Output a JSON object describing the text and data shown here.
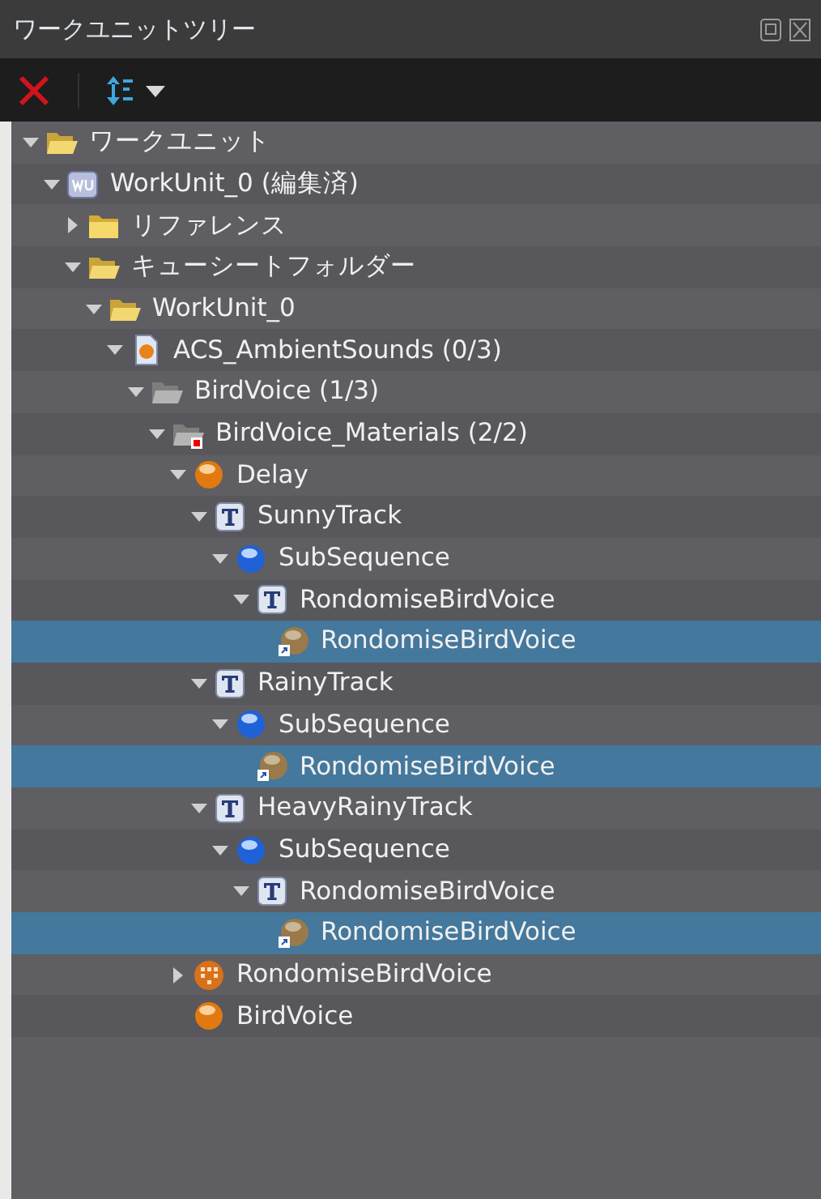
{
  "window": {
    "title": "ワークユニットツリー"
  },
  "tree": [
    {
      "label": "ワークユニット",
      "kind": "folder-open",
      "expanded": true,
      "selected": false,
      "children": [
        {
          "label": "WorkUnit_0 (編集済)",
          "kind": "workunit",
          "expanded": true,
          "selected": false,
          "children": [
            {
              "label": "リファレンス",
              "kind": "folder",
              "expanded": false,
              "selected": false
            },
            {
              "label": "キューシートフォルダー",
              "kind": "folder-open",
              "expanded": true,
              "selected": false,
              "children": [
                {
                  "label": "WorkUnit_0",
                  "kind": "folder-open",
                  "expanded": true,
                  "selected": false,
                  "children": [
                    {
                      "label": "ACS_AmbientSounds (0/3)",
                      "kind": "cuesheet",
                      "expanded": true,
                      "selected": false,
                      "children": [
                        {
                          "label": "BirdVoice (1/3)",
                          "kind": "grey-folder",
                          "expanded": true,
                          "selected": false,
                          "children": [
                            {
                              "label": "BirdVoice_Materials (2/2)",
                              "kind": "materials-folder",
                              "expanded": true,
                              "selected": false,
                              "children": [
                                {
                                  "label": "Delay",
                                  "kind": "orange-sphere",
                                  "expanded": true,
                                  "selected": false,
                                  "children": [
                                    {
                                      "label": "SunnyTrack",
                                      "kind": "track",
                                      "expanded": true,
                                      "selected": false,
                                      "children": [
                                        {
                                          "label": "SubSequence",
                                          "kind": "blue-sphere",
                                          "expanded": true,
                                          "selected": false,
                                          "children": [
                                            {
                                              "label": "RondomiseBirdVoice",
                                              "kind": "track",
                                              "expanded": true,
                                              "selected": false,
                                              "children": [
                                                {
                                                  "label": "RondomiseBirdVoice",
                                                  "kind": "shortcut",
                                                  "selected": true
                                                }
                                              ]
                                            }
                                          ]
                                        }
                                      ]
                                    },
                                    {
                                      "label": "RainyTrack",
                                      "kind": "track",
                                      "expanded": true,
                                      "selected": false,
                                      "children": [
                                        {
                                          "label": "SubSequence",
                                          "kind": "blue-sphere",
                                          "expanded": true,
                                          "selected": false,
                                          "children": [
                                            {
                                              "label": "RondomiseBirdVoice",
                                              "kind": "shortcut",
                                              "selected": true
                                            }
                                          ]
                                        }
                                      ]
                                    },
                                    {
                                      "label": "HeavyRainyTrack",
                                      "kind": "track",
                                      "expanded": true,
                                      "selected": false,
                                      "children": [
                                        {
                                          "label": "SubSequence",
                                          "kind": "blue-sphere",
                                          "expanded": true,
                                          "selected": false,
                                          "children": [
                                            {
                                              "label": "RondomiseBirdVoice",
                                              "kind": "track",
                                              "expanded": true,
                                              "selected": false,
                                              "children": [
                                                {
                                                  "label": "RondomiseBirdVoice",
                                                  "kind": "shortcut",
                                                  "selected": true
                                                }
                                              ]
                                            }
                                          ]
                                        }
                                      ]
                                    }
                                  ]
                                },
                                {
                                  "label": "RondomiseBirdVoice",
                                  "kind": "random",
                                  "expanded": false,
                                  "selected": false
                                },
                                {
                                  "label": "BirdVoice",
                                  "kind": "orange-sphere",
                                  "selected": false
                                }
                              ]
                            }
                          ]
                        }
                      ]
                    }
                  ]
                }
              ]
            }
          ]
        }
      ]
    }
  ]
}
